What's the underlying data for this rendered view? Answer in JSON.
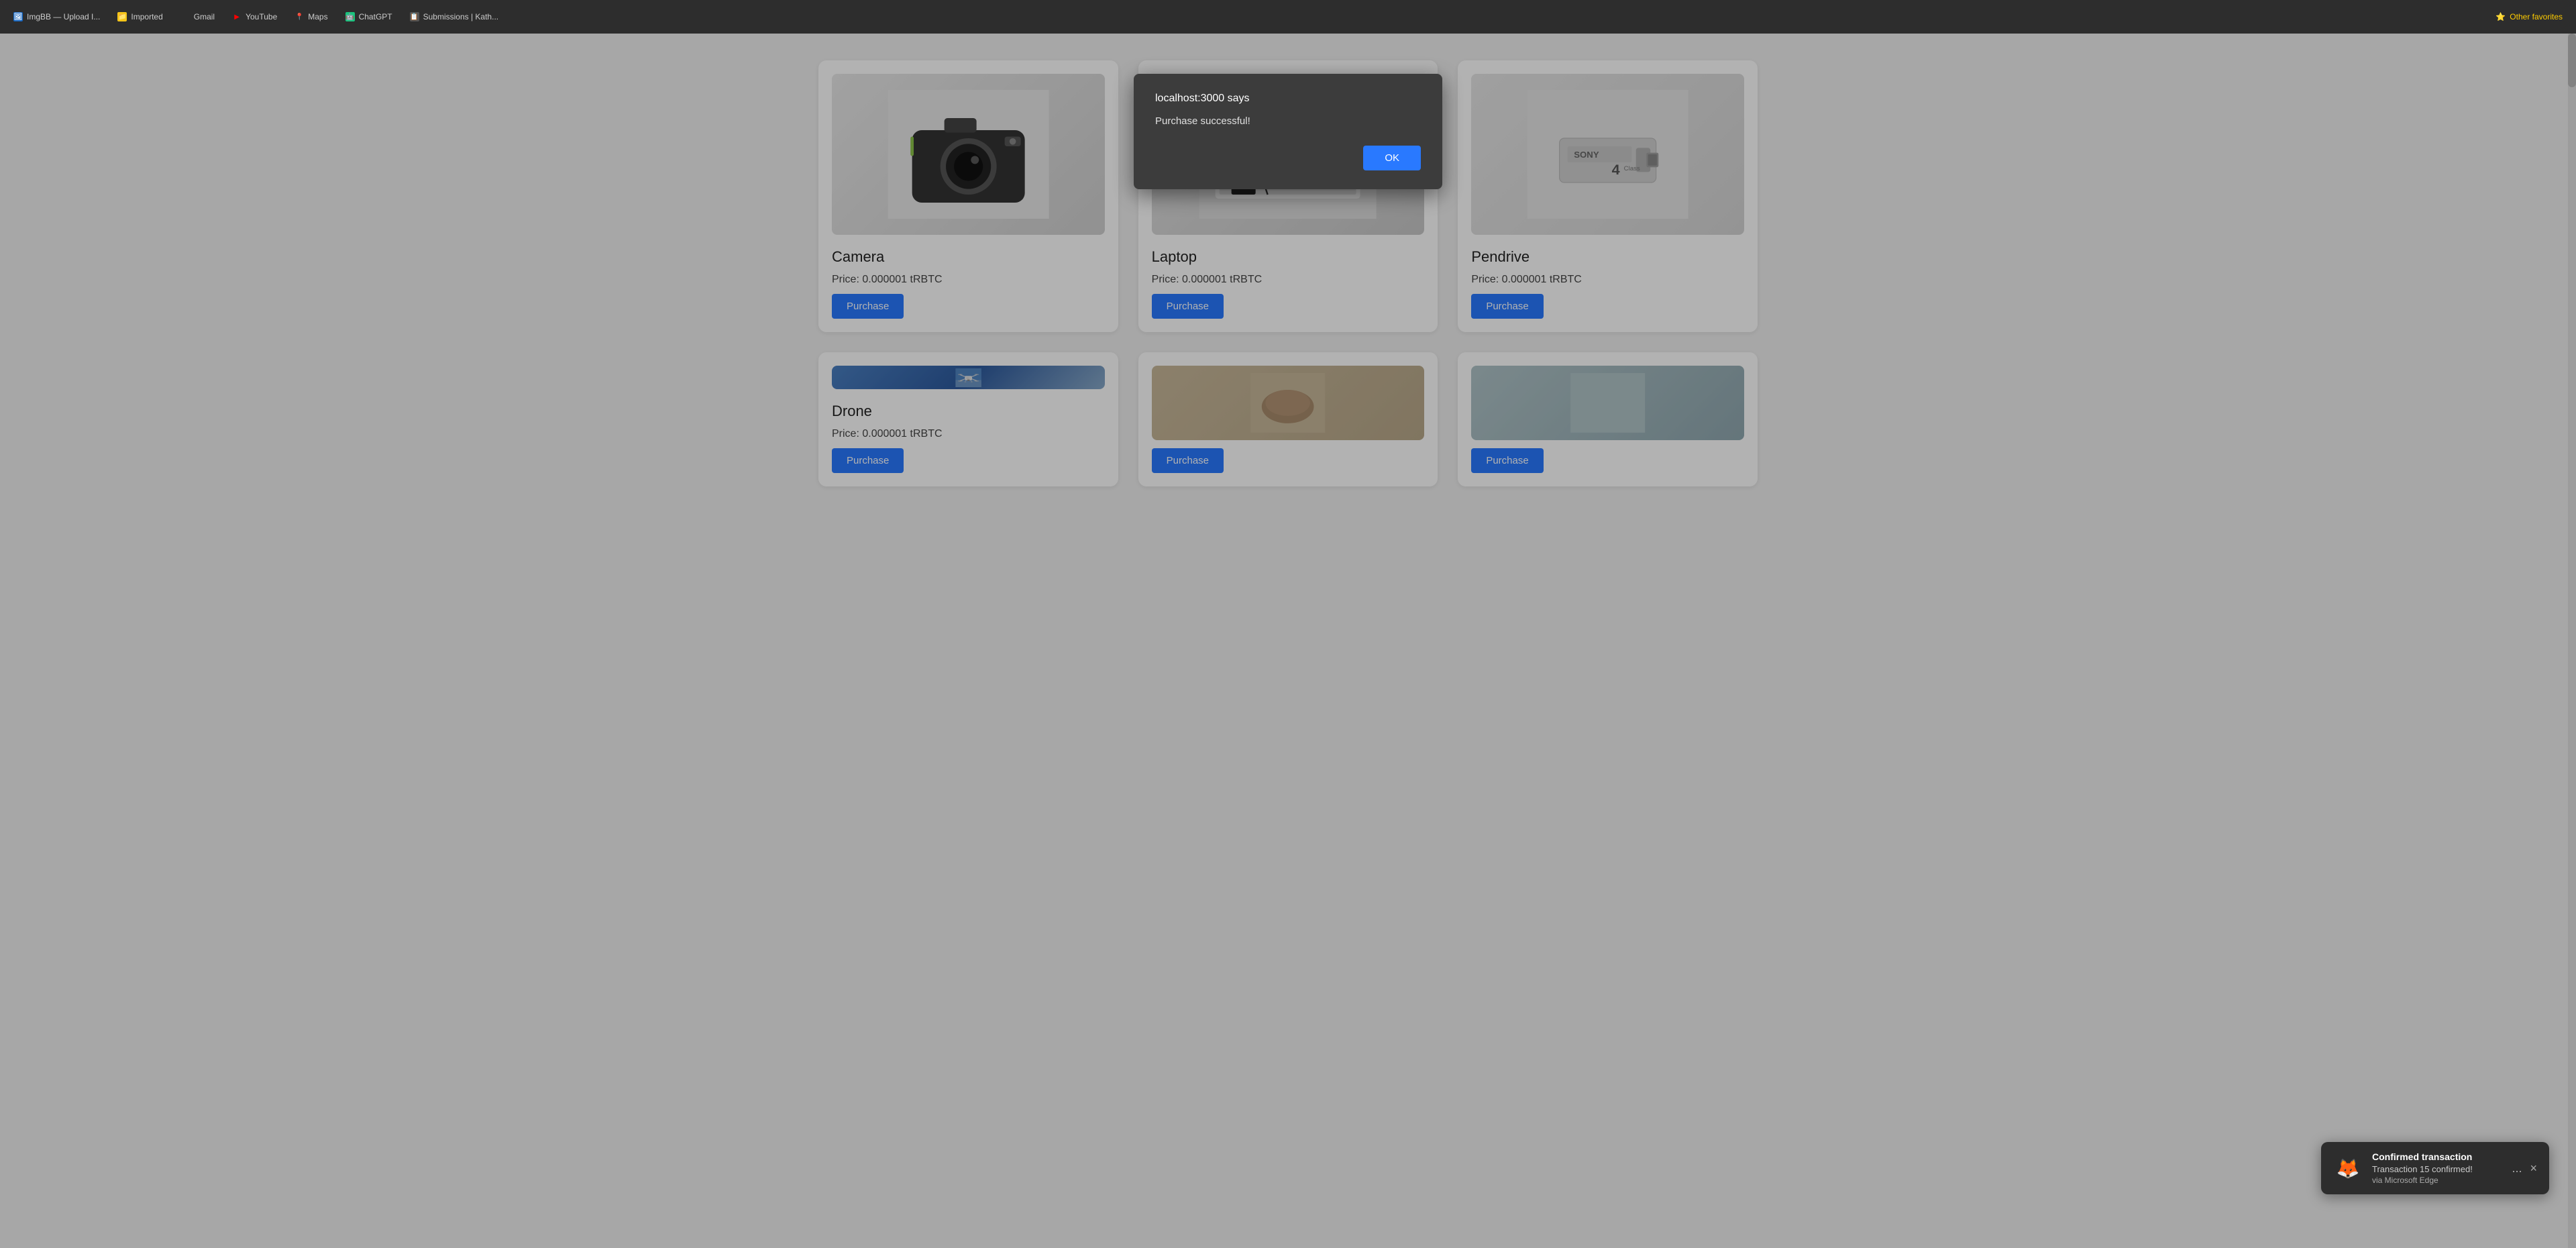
{
  "browser": {
    "tabs": [
      {
        "id": "imgbb",
        "label": "ImgBB — Upload I...",
        "favicon": "🖼",
        "favicon_class": "fav-imgbb"
      },
      {
        "id": "imported",
        "label": "Imported",
        "favicon": "📁",
        "favicon_class": "fav-imported"
      },
      {
        "id": "gmail",
        "label": "Gmail",
        "favicon": "✉",
        "favicon_class": "fav-gmail"
      },
      {
        "id": "youtube",
        "label": "YouTube",
        "favicon": "▶",
        "favicon_class": "fav-youtube"
      },
      {
        "id": "maps",
        "label": "Maps",
        "favicon": "📍",
        "favicon_class": "fav-maps"
      },
      {
        "id": "chatgpt",
        "label": "ChatGPT",
        "favicon": "🤖",
        "favicon_class": "fav-chatgpt"
      },
      {
        "id": "submissions",
        "label": "Submissions | Kath...",
        "favicon": "📋",
        "favicon_class": "fav-submissions"
      }
    ],
    "favorites_label": "Other favorites"
  },
  "dialog": {
    "title": "localhost:3000 says",
    "message": "Purchase successful!",
    "ok_label": "OK"
  },
  "products": [
    {
      "id": "camera",
      "name": "Camera",
      "price": "Price: 0.000001 tRBTC",
      "purchase_label": "Purchase",
      "image_type": "camera"
    },
    {
      "id": "laptop",
      "name": "Laptop",
      "price": "Price: 0.000001 tRBTC",
      "purchase_label": "Purchase",
      "image_type": "laptop"
    },
    {
      "id": "pendrive",
      "name": "Pendrive",
      "price": "Price: 0.000001 tRBTC",
      "purchase_label": "Purchase",
      "image_type": "pendrive"
    },
    {
      "id": "drone",
      "name": "Drone",
      "price": "Price: 0.000001 tRBTC",
      "purchase_label": "Purchase",
      "image_type": "drone"
    },
    {
      "id": "item5",
      "name": "",
      "price": "",
      "purchase_label": "Purchase",
      "image_type": "item5"
    },
    {
      "id": "item6",
      "name": "",
      "price": "",
      "purchase_label": "Purchase",
      "image_type": "item6"
    }
  ],
  "metamask": {
    "title": "Confirmed transaction",
    "transaction": "Transaction 15 confirmed!",
    "source": "via Microsoft Edge",
    "menu_label": "...",
    "close_label": "×"
  },
  "colors": {
    "purchase_btn": "#2979ff",
    "dialog_bg": "#3c3c3c",
    "ok_btn": "#2979ff",
    "browser_bar": "#2d2d2d"
  }
}
